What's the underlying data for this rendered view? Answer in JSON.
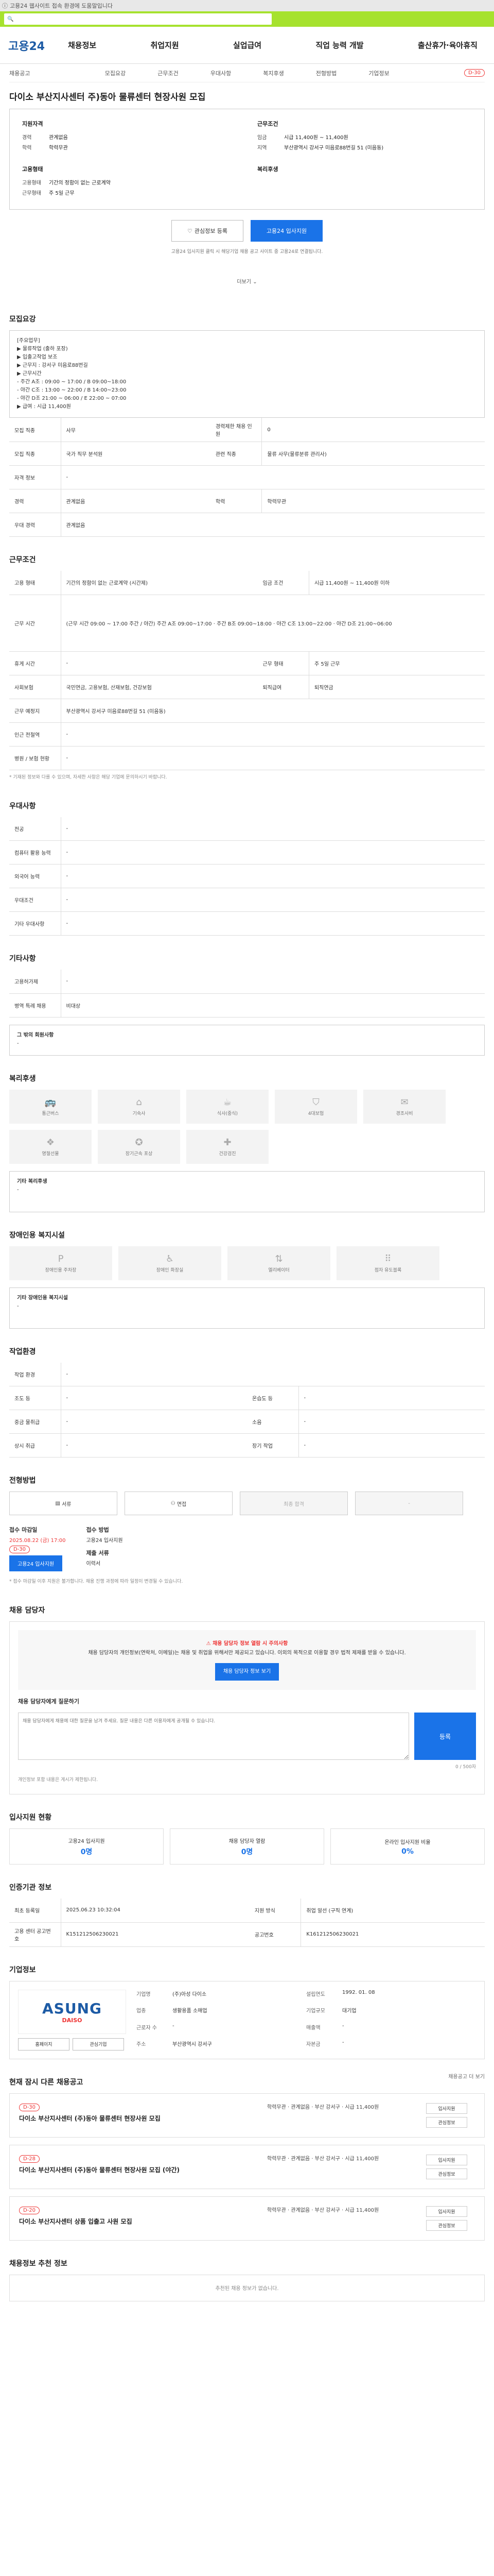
{
  "topbar": {
    "text": "고용24 웹사이트 접속 환경에 도움말입니다"
  },
  "header": {
    "logo": "고용24",
    "nav": [
      "채용정보",
      "취업지원",
      "실업급여",
      "직업 능력 개발",
      "출산휴가·육아휴직"
    ]
  },
  "job": {
    "tabs": [
      "모집요강",
      "근무조건",
      "우대사항",
      "복지후생",
      "전형방법",
      "기업정보"
    ],
    "company_short": "채용공고",
    "dday": "D-30",
    "title": "다이소 부산지사센터 주)동아 물류센터 현장사원 모집",
    "applicant_h": "지원자격",
    "conditions_h": "근무조건",
    "career_k": "경력",
    "career_v": "관계없음",
    "edu_k": "학력",
    "edu_v": "학력무관",
    "pay_k": "임금",
    "pay_v": "시급 11,400원 ~ 11,400원",
    "area_k": "지역",
    "area_v": "부산광역시 강서구 미음로88번길 51 (미음동)",
    "type_h": "고용형태",
    "type1_k": "고용형태",
    "type1_v": "기간의 정함이 없는 근로계약",
    "type2_k": "근무형태",
    "type2_v": "주 5일 근무",
    "welfare_h": "복리후생",
    "btn_interest": "관심정보 등록",
    "btn_apply": "고용24 입사지원",
    "notice": "고용24 입사지원 클릭 시 해당기업 채용 공고 사이트 중 고용24로 연결됩니다.",
    "more": "더보기"
  },
  "recruit": {
    "h": "모집요강",
    "body": [
      "[주요업무]",
      "▶ 물류작업 (출하 포장)",
      "▶ 입출고작업 보조",
      "▶ 근무지 : 강서구 미음로88번길",
      "▶ 근무시간",
      "- 주간 A조 : 09:00 ~ 17:00 / B 09:00~18:00",
      "- 야간 C조 : 13:00 ~ 22:00 / B 14:00~23:00",
      "- 야간 D조 21:00 ~ 06:00 / E 22:00 ~ 07:00",
      "▶ 급여 : 시급 11,400원"
    ],
    "rows": [
      [
        "모집 직종",
        "사무",
        "경력제한 채용 인원",
        "0"
      ],
      [
        "모집 직종",
        "국가 직무 분석원",
        "관련 직종",
        "물류 사무(물류분류 관리사)"
      ],
      [
        "자격 정보",
        "-",
        "",
        ""
      ],
      [
        "경력",
        "관계없음",
        "학력",
        "학력무관"
      ],
      [
        "우대 경력",
        "관계없음",
        "",
        ""
      ]
    ]
  },
  "work": {
    "h": "근무조건",
    "rows": [
      [
        "고용 형태",
        "기간의 정함이 없는 근로계약  (시간제)",
        "임금 조건",
        "시급 11,400원 ~ 11,400원 이하"
      ],
      [
        "근무 시간",
        "(근무 시간 09:00 ~ 17:00 주간 / 야간) 주간 A조 09:00~17:00 · 주간 B조 09:00~18:00 · 야간 C조 13:00~22:00 · 야간 D조 21:00~06:00",
        "",
        ""
      ],
      [
        "휴게 시간",
        "-",
        "근무 형태",
        "주 5일 근무"
      ],
      [
        "사회보험",
        "국민연금, 고용보험, 산재보험, 건강보험",
        "퇴직급여",
        "퇴직연금"
      ],
      [
        "근무 예정지",
        "부산광역시 강서구 미음로88번길 51 (미음동)",
        "",
        ""
      ],
      [
        "인근 전철역",
        "-",
        "",
        ""
      ],
      [
        "병원 / 보험 현황",
        "-",
        "",
        ""
      ]
    ],
    "note": "* 기재된 정보와 다를 수 있으며, 자세한 사항은 해당 기업에 문의하시기 바랍니다."
  },
  "prefer": {
    "h": "우대사항",
    "rows": [
      [
        "전공",
        "-"
      ],
      [
        "컴퓨터 활용 능력",
        "-"
      ],
      [
        "외국어 능력",
        "-"
      ],
      [
        "우대조건",
        "-"
      ],
      [
        "기타 우대사항",
        "-"
      ]
    ]
  },
  "etc": {
    "h": "기타사항",
    "rows": [
      [
        "고용허가제",
        "-"
      ],
      [
        "병역 특례 채용",
        "비대상"
      ]
    ],
    "extra_h": "그 밖의 회원사항",
    "extra_v": "-"
  },
  "welfare": {
    "h": "복리후생",
    "icons": [
      "통근버스",
      "기숙사",
      "식사(중식)",
      "4대보험",
      "경조사비",
      "명절선물",
      "장기근속 포상",
      "건강검진"
    ],
    "other_h": "기타 복리후생",
    "other_v": "-"
  },
  "disabled": {
    "h": "장애인용 복지시설",
    "icons": [
      "장애인용 주차장",
      "장애인 화장실",
      "엘리베이터",
      "점자 유도블록"
    ],
    "other_h": "기타 장애인용 복지시설",
    "other_v": "-"
  },
  "work_env": {
    "h": "작업환경",
    "rows": [
      [
        "작업 환경",
        "-",
        "",
        ""
      ],
      [
        "조도 등",
        "-",
        "온습도 등",
        "-"
      ],
      [
        "중금 물취급",
        "-",
        "소음",
        "-"
      ],
      [
        "상시 취급",
        "-",
        "장기 작업",
        "-"
      ]
    ]
  },
  "process": {
    "h": "전형방법",
    "steps": [
      "서류",
      "면접",
      "최종 합격",
      "-"
    ],
    "deadline_h": "접수 마감일",
    "deadline_v": "2025.08.22 (금) 17:00",
    "deadline_badge": "D-30",
    "method_h": "접수 방법",
    "method_v": "고용24 입사지원",
    "doc_h": "제출 서류",
    "doc_v": "이력서",
    "apply_btn": "고용24 입사지원",
    "notes": "* 접수 마감일 이후 지원은 불가합니다. 채용 진행 과정에 따라 일정이 변경될 수 있습니다."
  },
  "contact": {
    "h": "채용 담당자",
    "warn": "채용 담당자 정보 열람 시 주의사항",
    "warn_body": "채용 담당자의 개인정보(연락처, 이메일)는 채용 및 취업을 위해서만 제공되고 있습니다. 이외의 목적으로 이용할 경우 법적 제재를 받을 수 있습니다.",
    "btn1": "채용 담당자 정보 보기",
    "q_h": "채용 담당자에게 질문하기",
    "q_placeholder": "채용 담당자에게 채용에 대한 질문을 남겨 주세요. 질문 내용은 다른 이용자에게 공개될 수 있습니다.",
    "q_count": "0 / 500자",
    "q_btn": "등록",
    "q_note": "개인정보 포함 내용은 게시가 제한됩니다."
  },
  "stats": {
    "h": "입사지원 현황",
    "items": [
      {
        "label": "고용24 입사지원",
        "value": "0명"
      },
      {
        "label": "채용 담당자 열람",
        "value": "0명"
      },
      {
        "label": "온라인 입사지원 비율",
        "value": "0%"
      }
    ]
  },
  "info": {
    "h": "인증기관 정보",
    "rows": [
      [
        "최초 등록일",
        "2025.06.23 10:32:04",
        "지원 방식",
        "취업 알선 (구직 연계)"
      ],
      [
        "고용 센터 공고번호",
        "K151212506230021",
        "공고번호",
        "K161212506230021"
      ]
    ]
  },
  "company": {
    "h": "기업정보",
    "logo_a": "ASUNG",
    "logo_b": "DAISO",
    "btn_homepage": "홈페이지",
    "btn_interest": "관심기업",
    "fields": [
      [
        "기업명",
        "(주)아성 다이소",
        "설립연도",
        "1992. 01. 08"
      ],
      [
        "업종",
        "생활용품 소매업",
        "기업규모",
        "대기업"
      ],
      [
        "근로자 수",
        "-",
        "매출액",
        "-"
      ],
      [
        "주소",
        "부산광역시 강서구",
        "자본금",
        "-"
      ]
    ]
  },
  "related": {
    "h": "현재 잠시 다른 채용공고",
    "more": "채용공고 더 보기",
    "items": [
      {
        "dday": "D-30",
        "title": "다이소 부산지사센터 (주)동아 물류센터 현장사원 모집",
        "meta": "학력무관 · 관계없음 · 부산 강서구 · 시급 11,400원",
        "btns": [
          "입사지원",
          "관심정보"
        ]
      },
      {
        "dday": "D-28",
        "title": "다이소 부산지사센터 (주)동아 물류센터 현장사원 모집 (야간)",
        "meta": "학력무관 · 관계없음 · 부산 강서구 · 시급 11,400원",
        "btns": [
          "입사지원",
          "관심정보"
        ]
      },
      {
        "dday": "D-20",
        "title": "다이소 부산지사센터 상품 입출고 사원 모집",
        "meta": "학력무관 · 관계없음 · 부산 강서구 · 시급 11,400원",
        "btns": [
          "입사지원",
          "관심정보"
        ]
      }
    ]
  },
  "recommend": {
    "h": "채용정보 추천 정보",
    "empty": "추천된 채용 정보가 없습니다."
  }
}
